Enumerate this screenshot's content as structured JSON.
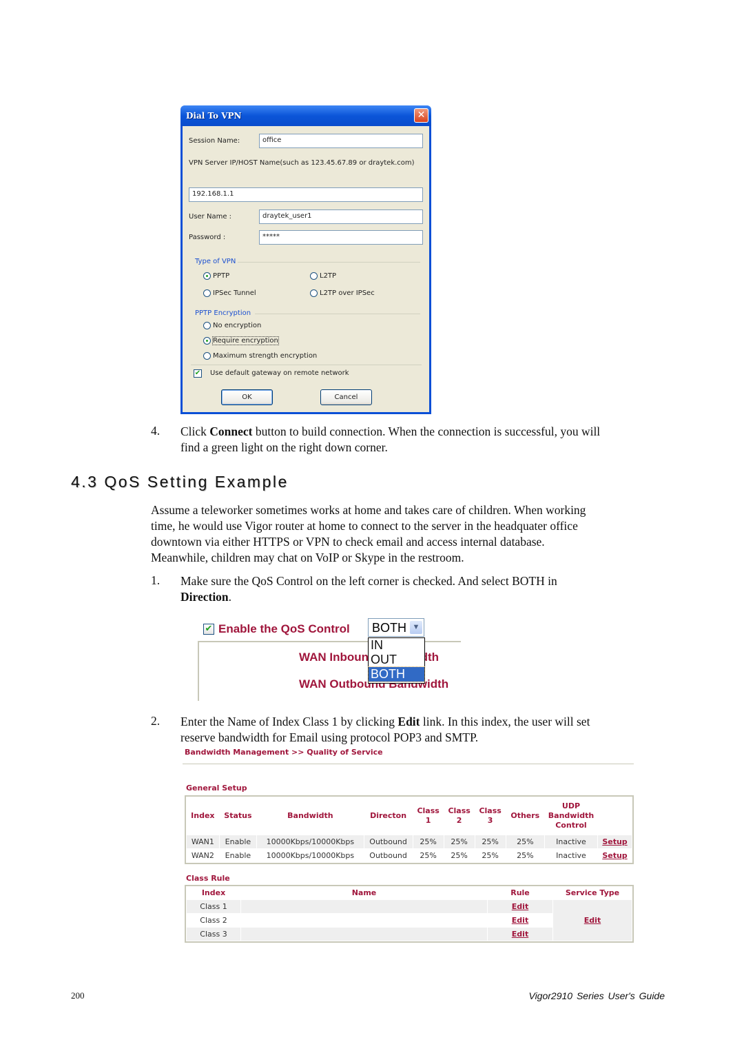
{
  "dialog": {
    "title": "Dial To VPN",
    "close_icon": "close-icon",
    "session_name_label": "Session Name:",
    "session_name_value": "office",
    "server_label": "VPN Server IP/HOST Name(such as 123.45.67.89 or draytek.com)",
    "server_value": "192.168.1.1",
    "username_label": "User Name :",
    "username_value": "draytek_user1",
    "password_label": "Password :",
    "password_value": "*****",
    "vpn_type": {
      "title": "Type of VPN",
      "options": [
        "PPTP",
        "L2TP",
        "IPSec Tunnel",
        "L2TP over IPSec"
      ],
      "selected": "PPTP"
    },
    "encryption": {
      "title": "PPTP Encryption",
      "options": [
        "No encryption",
        "Require encryption",
        "Maximum strength encryption"
      ],
      "selected": "Require encryption"
    },
    "default_gateway_label": "Use default gateway on remote network",
    "default_gateway_checked": true,
    "ok_label": "OK",
    "cancel_label": "Cancel"
  },
  "step4": {
    "number": "4.",
    "pre": "Click ",
    "bold": "Connect",
    "post": " button to build connection. When the connection is successful, you will",
    "line2": "find a green light on the right down corner."
  },
  "section_title": "4.3 QoS Setting Example",
  "intro": [
    "Assume a teleworker sometimes works at home and takes care of children. When working",
    "time, he would use Vigor router at home to connect to the server in the headquater office",
    "downtown via either HTTPS or VPN to check email and access internal database.",
    "Meanwhile, children may chat on VoIP or Skype in the restroom."
  ],
  "step1": {
    "number": "1.",
    "text": "Make sure the QoS Control on the left corner is checked. And select BOTH in",
    "bold": "Direction",
    "post": "."
  },
  "qos_control": {
    "label": "Enable the QoS Control",
    "checked": true,
    "direction_value": "BOTH",
    "direction_options": [
      "IN",
      "OUT",
      "BOTH"
    ],
    "highlighted": "BOTH",
    "wan_inbound": "WAN Inbound Bandwidth",
    "wan_outbound": "WAN Outbound Bandwidth"
  },
  "step2": {
    "number": "2.",
    "pre": "Enter the Name of Index Class 1 by clicking ",
    "bold": "Edit",
    "post": " link. In this index, the user will set",
    "line2": "reserve bandwidth for Email using protocol POP3 and SMTP."
  },
  "router_ui": {
    "breadcrumb": "Bandwidth Management >> Quality of Service",
    "general_setup": {
      "title": "General Setup",
      "headers": [
        "Index",
        "Status",
        "Bandwidth",
        "Directon",
        "Class 1",
        "Class 2",
        "Class 3",
        "Others",
        "UDP Bandwidth Control",
        ""
      ],
      "rows": [
        [
          "WAN1",
          "Enable",
          "10000Kbps/10000Kbps",
          "Outbound",
          "25%",
          "25%",
          "25%",
          "25%",
          "Inactive",
          "Setup"
        ],
        [
          "WAN2",
          "Enable",
          "10000Kbps/10000Kbps",
          "Outbound",
          "25%",
          "25%",
          "25%",
          "25%",
          "Inactive",
          "Setup"
        ]
      ]
    },
    "class_rule": {
      "title": "Class Rule",
      "headers": [
        "Index",
        "Name",
        "Rule",
        "Service Type"
      ],
      "rows": [
        {
          "index": "Class 1",
          "name": "",
          "rule": "Edit"
        },
        {
          "index": "Class 2",
          "name": "",
          "rule": "Edit"
        },
        {
          "index": "Class 3",
          "name": "",
          "rule": "Edit"
        }
      ],
      "service_type_link": "Edit"
    }
  },
  "footer": {
    "page_number": "200",
    "guide_title": "Vigor2910 Series User's Guide"
  }
}
